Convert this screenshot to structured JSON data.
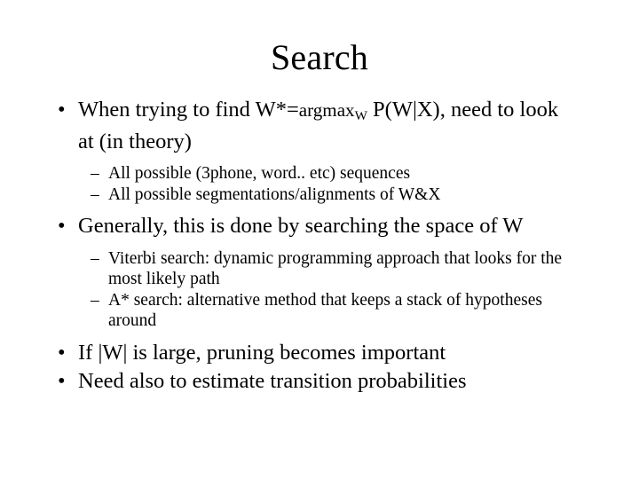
{
  "slide": {
    "title": "Search",
    "background_color": "#ffffff",
    "text_color": "#000000",
    "bullets": [
      {
        "level": 1,
        "marker": "bullet-dot",
        "marker_glyph": "•",
        "text_prefix": "When trying to find W*=",
        "formula_base": "argmax",
        "formula_sub": "W",
        "text_suffix": " P(W|X), need to look at (in theory)"
      },
      {
        "level": 2,
        "marker": "en-dash",
        "marker_glyph": "–",
        "text": "All possible (3phone, word.. etc) sequences"
      },
      {
        "level": 2,
        "marker": "en-dash",
        "marker_glyph": "–",
        "text": "All possible segmentations/alignments of W&X"
      },
      {
        "level": 1,
        "marker": "bullet-dot",
        "marker_glyph": "•",
        "text": "Generally, this is done by searching the space of W"
      },
      {
        "level": 2,
        "marker": "en-dash",
        "marker_glyph": "–",
        "text": "Viterbi search: dynamic programming approach that looks for the most likely path"
      },
      {
        "level": 2,
        "marker": "en-dash",
        "marker_glyph": "–",
        "text": "A* search: alternative method that keeps a stack of hypotheses around"
      },
      {
        "level": 1,
        "marker": "bullet-dot",
        "marker_glyph": "•",
        "text": "If |W| is large, pruning becomes important"
      },
      {
        "level": 1,
        "marker": "bullet-dot",
        "marker_glyph": "•",
        "text": "Need also to estimate transition probabilities"
      }
    ]
  }
}
